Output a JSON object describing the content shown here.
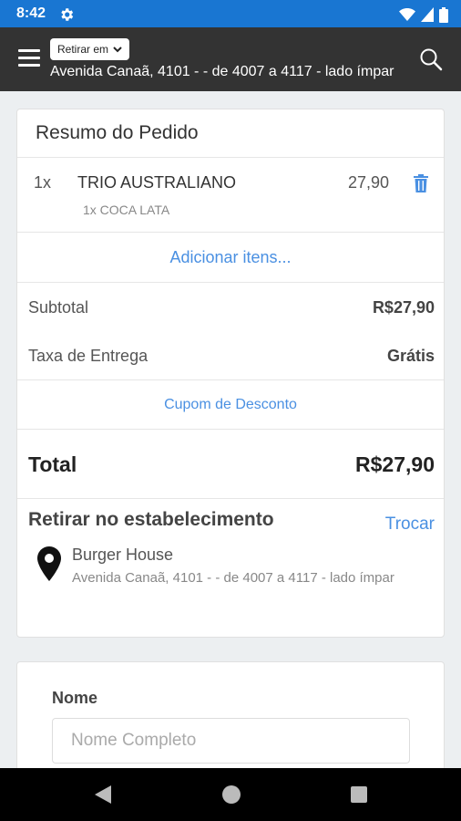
{
  "status": {
    "time": "8:42"
  },
  "header": {
    "mode_label": "Retirar em",
    "address": "Avenida Canaã, 4101 - - de 4007 a 4117 - lado ímpar"
  },
  "order": {
    "title": "Resumo do Pedido",
    "items": [
      {
        "qty": "1x",
        "name": "TRIO AUSTRALIANO",
        "extra": "1x COCA LATA",
        "price": "27,90"
      }
    ],
    "add_items_label": "Adicionar itens...",
    "subtotal_label": "Subtotal",
    "subtotal_value": "R$27,90",
    "delivery_label": "Taxa de Entrega",
    "delivery_value": "Grátis",
    "coupon_label": "Cupom de Desconto",
    "total_label": "Total",
    "total_value": "R$27,90"
  },
  "pickup": {
    "title": "Retirar no estabelecimento",
    "change_label": "Trocar",
    "store_name": "Burger House",
    "store_address": "Avenida Canaã, 4101 - - de 4007 a 4117 - lado ímpar"
  },
  "form": {
    "name_label": "Nome",
    "name_placeholder": "Nome Completo",
    "name_value": ""
  },
  "colors": {
    "status_bar": "#1976d2",
    "app_bar": "#333333",
    "accent": "#4a90e2"
  },
  "icons": [
    "settings-icon",
    "wifi-icon",
    "signal-icon",
    "battery-icon",
    "menu-icon",
    "chevron-down-icon",
    "search-icon",
    "trash-icon",
    "location-pin-icon",
    "back-icon",
    "home-icon",
    "recents-icon"
  ]
}
